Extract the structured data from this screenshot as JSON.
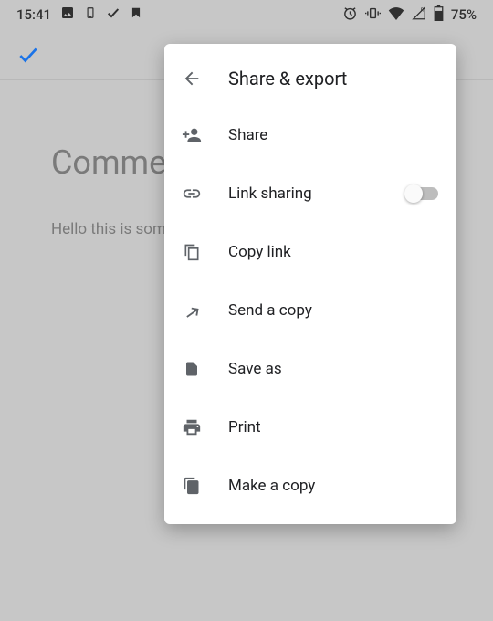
{
  "status_bar": {
    "time": "15:41",
    "battery": "75%"
  },
  "document": {
    "title": "Comments usage",
    "body": "Hello this is some"
  },
  "panel": {
    "title": "Share & export",
    "items": [
      {
        "label": "Share"
      },
      {
        "label": "Link sharing"
      },
      {
        "label": "Copy link"
      },
      {
        "label": "Send a copy"
      },
      {
        "label": "Save as"
      },
      {
        "label": "Print"
      },
      {
        "label": "Make a copy"
      }
    ]
  }
}
